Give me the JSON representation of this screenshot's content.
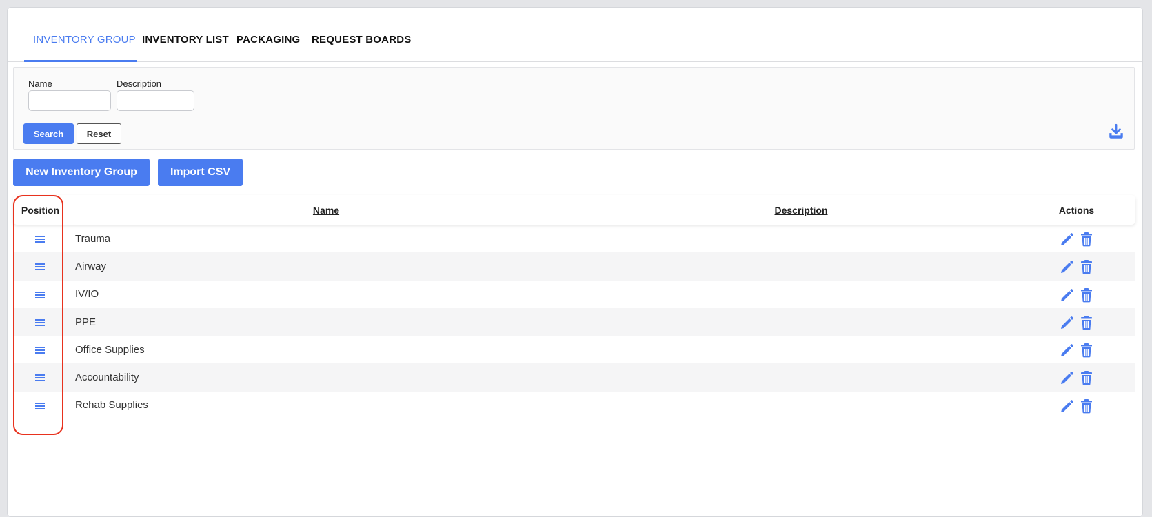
{
  "tabs": [
    {
      "label": "INVENTORY GROUP",
      "active": true
    },
    {
      "label": "INVENTORY LIST",
      "active": false
    },
    {
      "label": "PACKAGING",
      "active": false
    },
    {
      "label": "REQUEST BOARDS",
      "active": false
    }
  ],
  "filter": {
    "name_label": "Name",
    "name_value": "",
    "description_label": "Description",
    "description_value": "",
    "search_label": "Search",
    "reset_label": "Reset",
    "download_icon": "download-icon"
  },
  "actions": {
    "new_group_label": "New Inventory Group",
    "import_label": "Import CSV"
  },
  "table": {
    "columns": [
      "Position",
      "Name",
      "Description",
      "Actions"
    ],
    "rows": [
      {
        "name": "Trauma",
        "description": ""
      },
      {
        "name": "Airway",
        "description": ""
      },
      {
        "name": "IV/IO",
        "description": ""
      },
      {
        "name": "PPE",
        "description": ""
      },
      {
        "name": "Office Supplies",
        "description": ""
      },
      {
        "name": "Accountability",
        "description": ""
      },
      {
        "name": "Rehab Supplies",
        "description": ""
      }
    ]
  },
  "colors": {
    "accent": "#4a7cf0",
    "highlight": "#e8321e"
  }
}
